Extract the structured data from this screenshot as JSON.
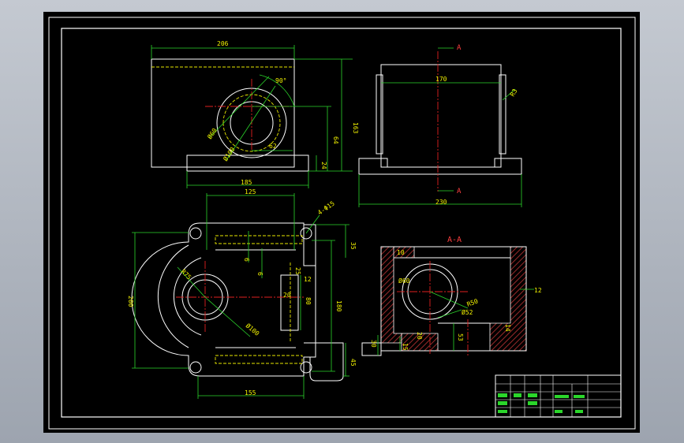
{
  "colors": {
    "background": "#000000",
    "outline": "#ffffff",
    "dimension": "#2bd62b",
    "center_line": "#e02020",
    "hidden_line": "#e8e800",
    "dim_text": "#f2f200",
    "section_hatch": "#9a2a2a",
    "section_label": "#ff4040"
  },
  "front_view": {
    "dims": {
      "width": "206",
      "height": "163",
      "d60": "Ø60",
      "d100": "Ø100",
      "angle": "90°",
      "offset": "62",
      "center_height": "64",
      "base_height": "24",
      "base_width": "185"
    }
  },
  "side_view": {
    "section_mark": "A",
    "dims": {
      "inner": "170",
      "chamfer": "R3",
      "width": "230"
    }
  },
  "top_view": {
    "dims": {
      "top_width": "125",
      "holes": "4-Φ15",
      "rib": "6",
      "rib2": "6",
      "depth": "35",
      "slot_a": "25",
      "slot_b": "12",
      "r75": "R75",
      "slot_c": "20",
      "slot_d": "80",
      "height": "200",
      "length": "180",
      "d100": "Ø100",
      "base_off": "45",
      "bottom_width": "155"
    }
  },
  "section_view": {
    "title": "A-A",
    "dims": {
      "top": "10",
      "wall": "12",
      "d60": "Ø60",
      "r50": "R50",
      "d52": "Ø52",
      "h20": "20",
      "h53": "53",
      "h30": "30",
      "h15": "15",
      "rib": "14"
    }
  },
  "title_block": {
    "rows": [
      [
        "",
        "",
        "",
        "",
        "",
        "",
        ""
      ],
      [
        "",
        "",
        "",
        "",
        "",
        "",
        ""
      ],
      [
        "",
        "",
        "",
        "",
        "",
        "",
        ""
      ],
      [
        "",
        "",
        "",
        "",
        "",
        "",
        ""
      ],
      [
        "",
        "",
        "",
        "",
        "",
        "",
        ""
      ]
    ]
  }
}
